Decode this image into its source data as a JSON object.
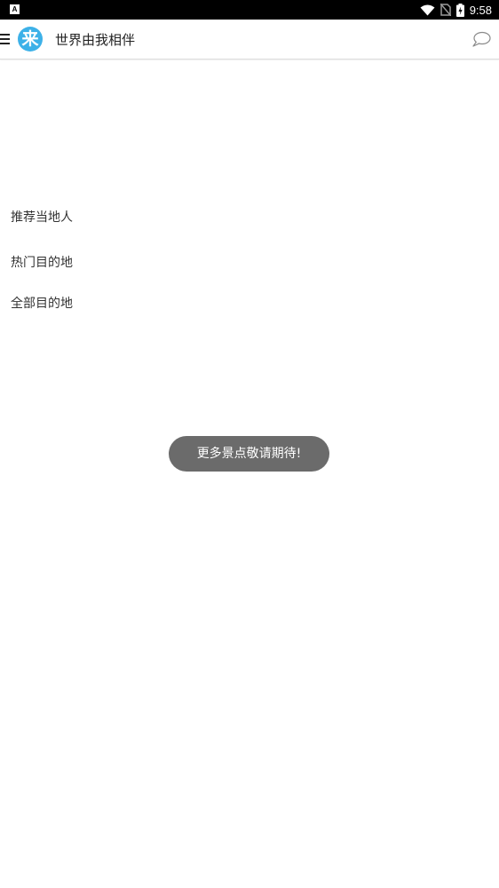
{
  "status_bar": {
    "left_icon_letter": "A",
    "left_icon": "notification-a-icon",
    "icons": [
      "wifi-icon",
      "no-sim-icon",
      "battery-charging-icon"
    ],
    "time": "9:58"
  },
  "app_bar": {
    "menu_icon": "hamburger-menu-icon",
    "logo_char": "来",
    "logo_color": "#3db1e8",
    "title": "世界由我相伴",
    "chat_icon": "chat-bubble-icon"
  },
  "menu": {
    "items": [
      {
        "label": "推荐当地人"
      },
      {
        "label": "热门目的地"
      },
      {
        "label": "全部目的地"
      }
    ]
  },
  "toast": {
    "text": "更多景点敬请期待!"
  }
}
